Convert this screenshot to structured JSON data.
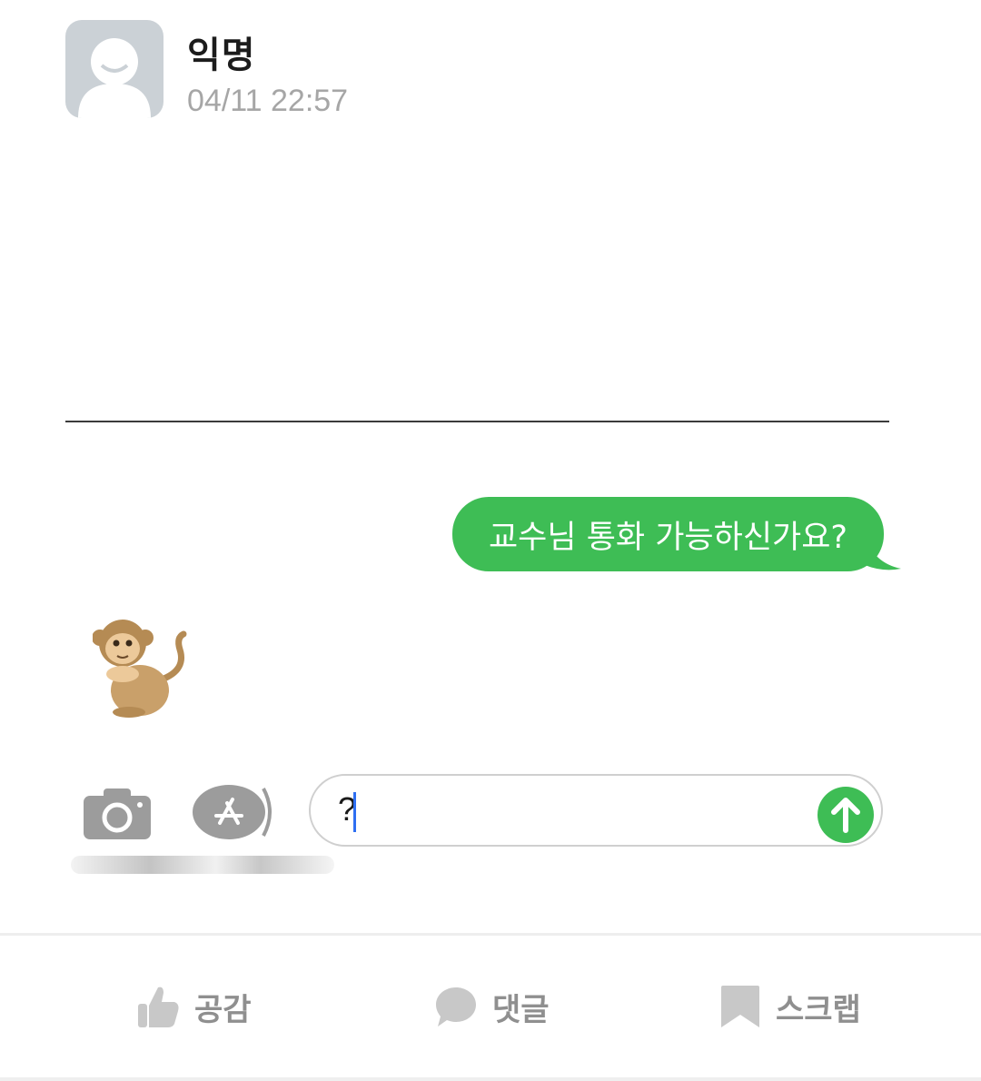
{
  "post": {
    "author": "익명",
    "timestamp": "04/11 22:57"
  },
  "screenshot": {
    "sent_message": "교수님 통화 가능하신가요?",
    "received_emoji": "🙊",
    "input_value": "?"
  },
  "actions": {
    "like_label": "공감",
    "comment_label": "댓글",
    "scrap_label": "스크랩"
  },
  "colors": {
    "bubble_green": "#3ebd55",
    "action_gray": "#8f8f8f",
    "avatar_bg": "#cbd1d6"
  }
}
